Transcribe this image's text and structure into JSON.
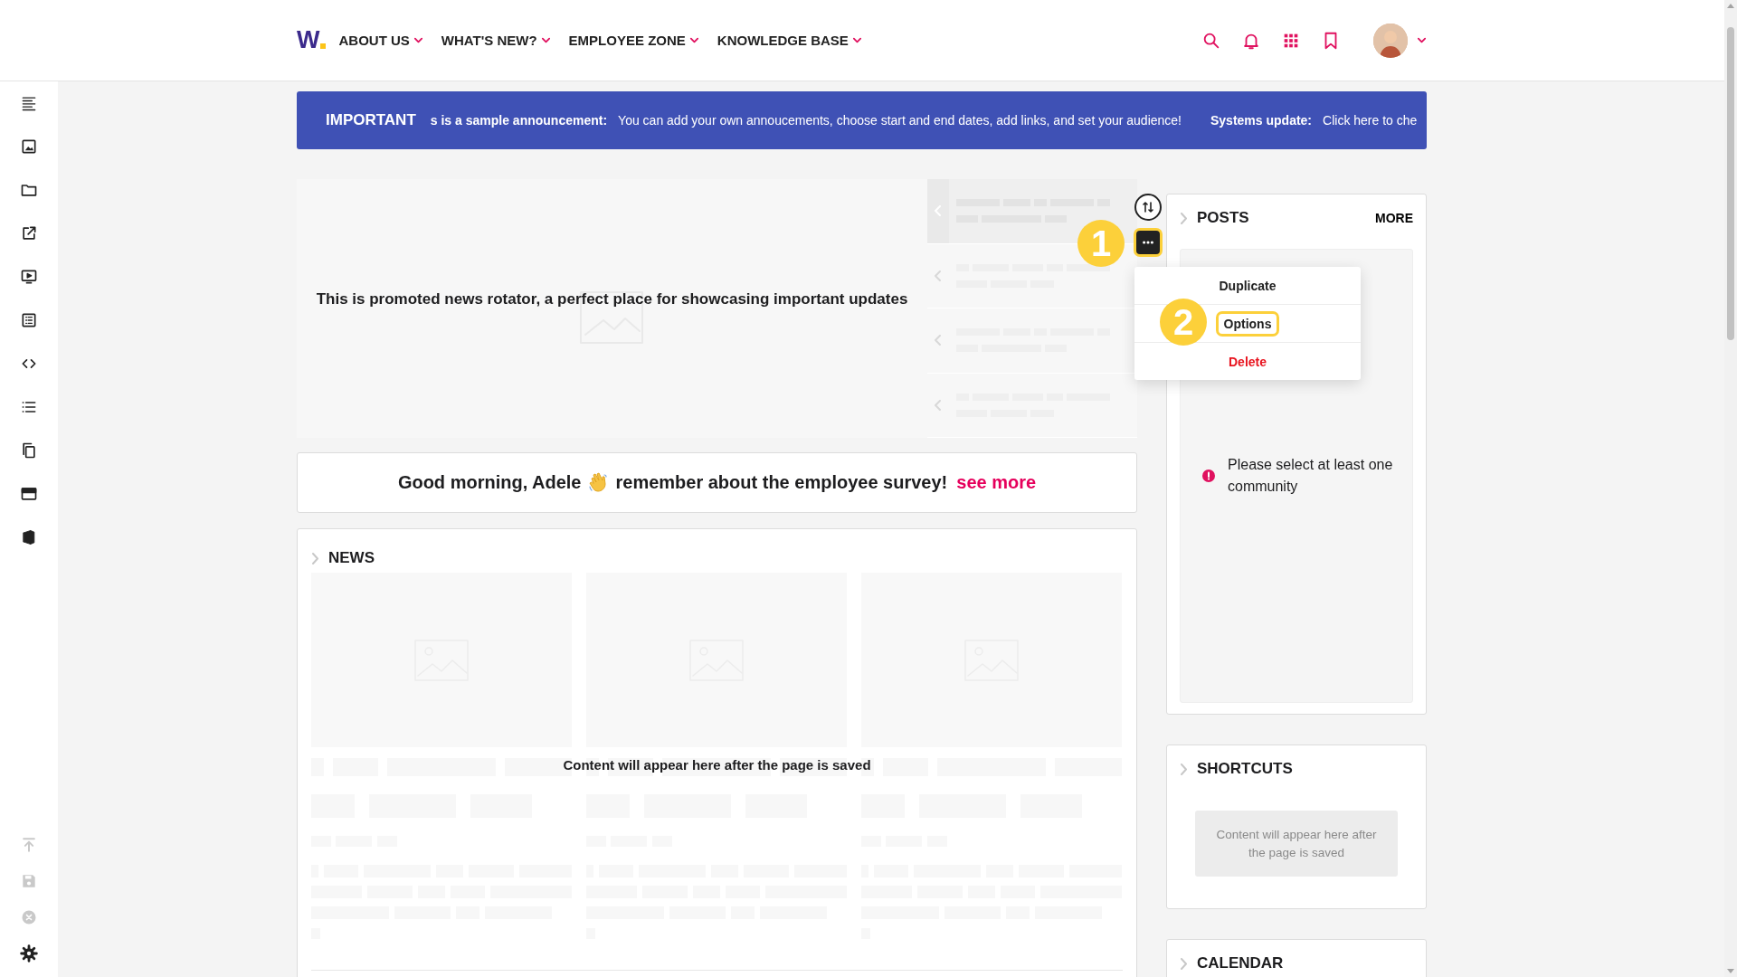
{
  "header": {
    "logo": "W",
    "nav": [
      {
        "label": "ABOUT US"
      },
      {
        "label": "WHAT'S NEW?"
      },
      {
        "label": "EMPLOYEE ZONE"
      },
      {
        "label": "KNOWLEDGE BASE"
      }
    ]
  },
  "sidebar": {
    "bottom_actions": [
      {
        "kind": "publish",
        "disabled": true
      },
      {
        "kind": "save",
        "disabled": true
      },
      {
        "kind": "cancel",
        "disabled": true
      },
      {
        "kind": "settings",
        "disabled": false
      }
    ]
  },
  "announcement": {
    "label": "IMPORTANT",
    "items": [
      {
        "title": "s is a sample announcement:",
        "text": "You can add your own annoucements, choose start and end dates, add links, and set your audience!"
      },
      {
        "title": "Systems update:",
        "text": "Click here to che"
      }
    ]
  },
  "rotator": {
    "caption": "This is promoted news rotator, a perfect place for showcasing important updates",
    "items": [
      {
        "selected": true
      },
      {
        "selected": false
      },
      {
        "selected": false
      },
      {
        "selected": false
      }
    ]
  },
  "toolbar": {
    "badge": "1",
    "menu": [
      {
        "label": "Duplicate",
        "kind": "normal",
        "highlighted": false
      },
      {
        "label": "Options",
        "kind": "normal",
        "highlighted": true,
        "badge": "2"
      },
      {
        "label": "Delete",
        "kind": "danger",
        "highlighted": false
      }
    ]
  },
  "greeting": {
    "before": "Good morning, Adele",
    "after": "remember about the employee survey!",
    "link": "see more"
  },
  "news": {
    "title": "NEWS",
    "overlay": "Content will appear here after the page is saved",
    "items": [
      {
        "kind": "placeholder"
      },
      {
        "kind": "placeholder"
      },
      {
        "kind": "placeholder"
      }
    ]
  },
  "posts": {
    "title": "POSTS",
    "more": "MORE",
    "message": "Please select at least one community"
  },
  "shortcuts": {
    "title": "SHORTCUTS",
    "placeholder": "Content will appear here after the page is saved"
  },
  "calendar": {
    "title": "CALENDAR"
  }
}
